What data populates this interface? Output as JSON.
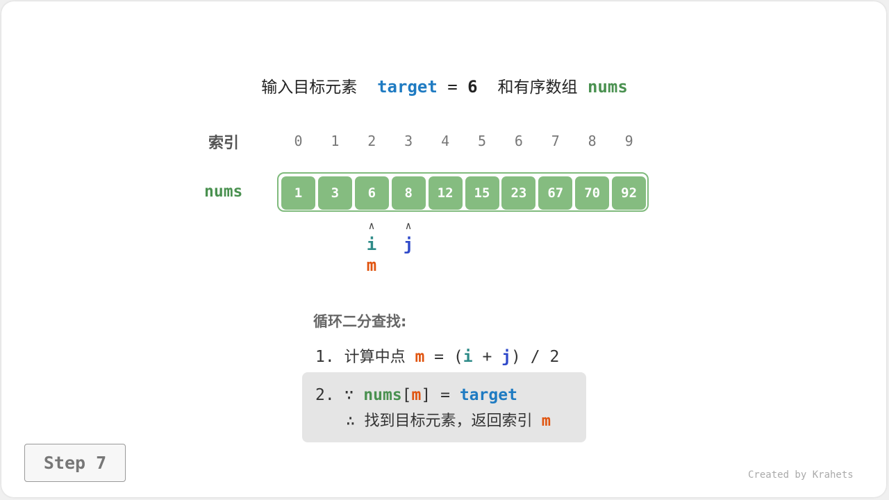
{
  "headline": {
    "prefix": "输入目标元素",
    "target_kw": "target",
    "equals": "=",
    "target_value": "6",
    "middle": "和有序数组",
    "nums_kw": "nums"
  },
  "index_label": "索引",
  "nums_label": "nums",
  "indices": [
    "0",
    "1",
    "2",
    "3",
    "4",
    "5",
    "6",
    "7",
    "8",
    "9"
  ],
  "nums": [
    "1",
    "3",
    "6",
    "8",
    "12",
    "15",
    "23",
    "67",
    "70",
    "92"
  ],
  "pointers": {
    "arrow": "∧",
    "i": "i",
    "j": "j",
    "m": "m"
  },
  "loop": {
    "title": "循环二分查找:",
    "step1": {
      "num": "1.",
      "text": "计算中点",
      "m": "m",
      "eq": "=",
      "lparen": "(",
      "i": "i",
      "plus": "+",
      "j": "j",
      "rparen": ")",
      "div": "/ 2"
    },
    "step2": {
      "num": "2.",
      "because": "∵",
      "nums": "nums",
      "lbr": "[",
      "m": "m",
      "rbr": "]",
      "eq": "=",
      "target": "target",
      "therefore": "∴",
      "conclusion": "找到目标元素，返回索引",
      "m2": "m"
    }
  },
  "step_button": "Step 7",
  "credit": "Created by Krahets",
  "colors": {
    "cell": "#85bc80",
    "border": "#7fba7c",
    "target": "#1f7bc2",
    "nums": "#4a9150",
    "i": "#2e8b88",
    "j": "#2f49c9",
    "m": "#e0540f"
  }
}
